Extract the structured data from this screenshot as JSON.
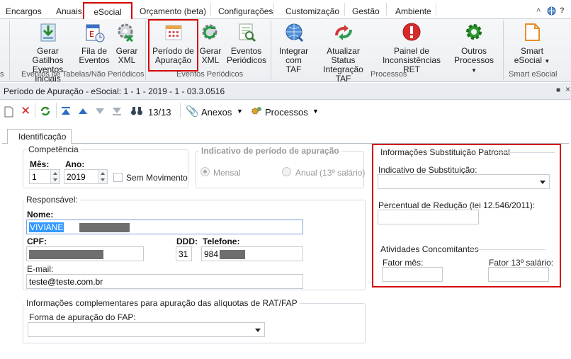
{
  "ribbon_tabs": [
    "Encargos",
    "Anuais",
    "eSocial",
    "Orçamento (beta)",
    "Configurações",
    "Customização",
    "Gestão",
    "Ambiente"
  ],
  "ribbon": {
    "buttons": [
      {
        "label1": "Gerar Gatilhos",
        "label2": "Eventos Iniciais",
        "icon": "download-sheet-icon"
      },
      {
        "label1": "Fila de",
        "label2": "Eventos",
        "icon": "event-queue-icon"
      },
      {
        "label1": "Gerar",
        "label2": "XML",
        "icon": "xml-gear-icon"
      },
      {
        "label1": "Período de",
        "label2": "Apuração",
        "icon": "calendar-icon"
      },
      {
        "label1": "Gerar",
        "label2": "XML",
        "icon": "xml-refresh-icon"
      },
      {
        "label1": "Eventos",
        "label2": "Periódicos",
        "icon": "periodic-events-icon"
      },
      {
        "label1": "Integrar",
        "label2": "com TAF",
        "icon": "globe-icon"
      },
      {
        "label1": "Atualizar Status",
        "label2": "Integração TAF",
        "icon": "sync-arrows-icon"
      },
      {
        "label1": "Painel de",
        "label2": "Inconsistências RET",
        "icon": "warning-icon"
      },
      {
        "label1": "Outros",
        "label2": "Processos",
        "icon": "gear-icon"
      },
      {
        "label1": "Smart",
        "label2": "eSocial",
        "icon": "smart-doc-icon"
      }
    ],
    "groups": [
      "Eventos de Tabelas/Não Periódicos",
      "Eventos Periódicos",
      "Processos",
      "Smart eSocial"
    ]
  },
  "window": {
    "title": "Período de Apuração - eSocial: 1 - 1 - 2019 - 1 - 03.3.0516"
  },
  "toolbar": {
    "counter": "13/13",
    "anexos": "Anexos",
    "processos": "Processos"
  },
  "tabs": {
    "identificacao": "Identificação"
  },
  "competencia": {
    "title": "Competência",
    "mes_label": "Mês:",
    "mes_value": "1",
    "ano_label": "Ano:",
    "ano_value": "2019",
    "sem_movimento": "Sem Movimento"
  },
  "indicativo": {
    "title": "Indicativo de período de apuração",
    "mensal": "Mensal",
    "anual": "Anual (13º salário)"
  },
  "responsavel": {
    "title": "Responsável:",
    "nome_label": "Nome:",
    "nome_value": "VIVIANE",
    "cpf_label": "CPF:",
    "ddd_label": "DDD:",
    "ddd_value": "31",
    "telefone_label": "Telefone:",
    "telefone_value": "984",
    "email_label": "E-mail:",
    "email_value": "teste@teste.com.br"
  },
  "rat_fap": {
    "title": "Informações complementares para apuração das alíquotas de RAT/FAP",
    "forma_label": "Forma de apuração do FAP:"
  },
  "substituicao": {
    "title": "Informações Substituição Patronal",
    "indicativo_label": "Indicativo de Substituição:",
    "percentual_label": "Percentual de Redução  (lei 12.546/2011):"
  },
  "atividades": {
    "title": "Atividades Concomitantes",
    "fator_mes": "Fator mês:",
    "fator_13": "Fator 13º salário:"
  }
}
